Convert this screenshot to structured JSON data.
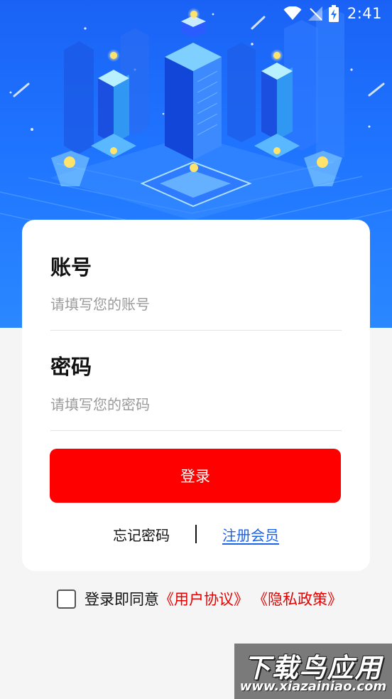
{
  "status_bar": {
    "time": "2:41",
    "icons": [
      "wifi-icon",
      "signal-icon",
      "battery-charging-icon"
    ]
  },
  "hero": {
    "illustration": "isometric-city-illustration"
  },
  "login_form": {
    "account_label": "账号",
    "account_placeholder": "请填写您的账号",
    "account_value": "",
    "password_label": "密码",
    "password_placeholder": "请填写您的密码",
    "password_value": "",
    "login_button": "登录",
    "forgot_password": "忘记密码",
    "separator": "|",
    "register": "注册会员"
  },
  "agreement": {
    "checked": false,
    "prefix": "登录即同意",
    "user_agreement": "《用户协议》",
    "privacy_policy": "《隐私政策》"
  },
  "watermark": {
    "title": "下载鸟应用",
    "url": "www.xiazainiao.com"
  },
  "colors": {
    "hero_blue": "#1f74ff",
    "primary_red": "#fe0000",
    "link_blue": "#1a62e8",
    "agreement_red": "#e80000"
  }
}
